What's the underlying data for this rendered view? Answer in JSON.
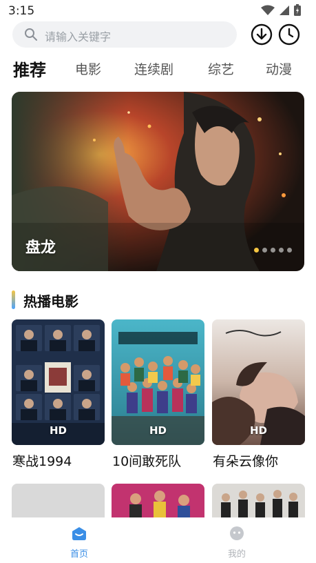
{
  "status_bar": {
    "time": "3:15"
  },
  "search": {
    "placeholder": "请输入关键字"
  },
  "tabs": [
    {
      "label": "推荐",
      "active": true
    },
    {
      "label": "电影",
      "active": false
    },
    {
      "label": "连续剧",
      "active": false
    },
    {
      "label": "综艺",
      "active": false
    },
    {
      "label": "动漫",
      "active": false
    }
  ],
  "banner": {
    "title": "盘龙",
    "slides": 5,
    "active_slide": 1
  },
  "section": {
    "title": "热播电影"
  },
  "movies": [
    {
      "title": "寒战1994",
      "quality": "HD"
    },
    {
      "title": "10间敢死队",
      "quality": "HD"
    },
    {
      "title": "有朵云像你",
      "quality": "HD"
    }
  ],
  "bottom_nav": [
    {
      "label": "首页",
      "icon": "home-icon",
      "active": true
    },
    {
      "label": "我的",
      "icon": "profile-icon",
      "active": false
    }
  ],
  "colors": {
    "accent": "#3a8ee6",
    "inactive": "#c5c8cd",
    "dot_active": "#f5c542"
  }
}
